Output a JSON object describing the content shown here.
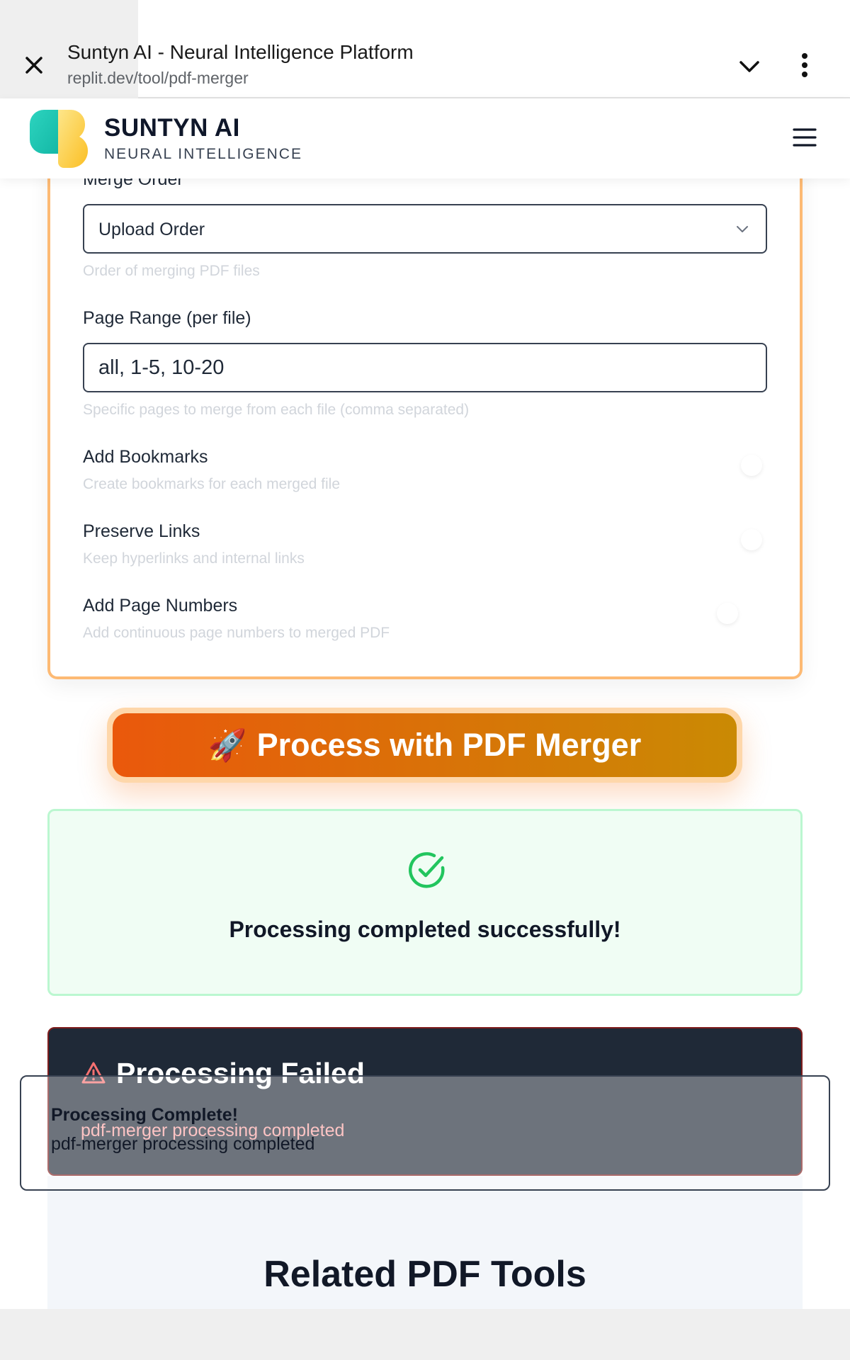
{
  "browser": {
    "title": "Suntyn AI - Neural Intelligence Platform",
    "url": "replit.dev/tool/pdf-merger",
    "close_icon": "close-icon",
    "chevron_icon": "chevron-down-icon",
    "menu_icon": "more-vertical-icon"
  },
  "header": {
    "brand": "SUNTYN AI",
    "tagline": "NEURAL INTELLIGENCE",
    "menu_icon": "hamburger-menu-icon"
  },
  "settings": {
    "merge_order": {
      "label": "Merge Order",
      "value": "Upload Order",
      "help": "Order of merging PDF files"
    },
    "page_range": {
      "label": "Page Range (per file)",
      "value": "all, 1-5, 10-20",
      "help": "Specific pages to merge from each file (comma separated)"
    },
    "bookmarks": {
      "label": "Add Bookmarks",
      "help": "Create bookmarks for each merged file"
    },
    "links": {
      "label": "Preserve Links",
      "help": "Keep hyperlinks and internal links"
    },
    "page_numbers": {
      "label": "Add Page Numbers",
      "help": "Add continuous page numbers to merged PDF"
    }
  },
  "process_button": {
    "icon": "🚀",
    "label": "Process with PDF Merger"
  },
  "success": {
    "icon": "check-circle-icon",
    "message": "Processing completed successfully!"
  },
  "failed": {
    "icon": "warning-triangle-icon",
    "title": "Processing Failed",
    "message": "pdf-merger processing completed"
  },
  "toast": {
    "title": "Processing Complete!",
    "message": "pdf-merger processing completed"
  },
  "related": {
    "title": "Related PDF Tools"
  },
  "colors": {
    "accent_orange": "#ea580c",
    "accent_gold": "#ca8a04",
    "card_border": "#fdba74",
    "success_green": "#22c55e",
    "error_red": "#f87171",
    "dark_panel": "#1f2937"
  }
}
